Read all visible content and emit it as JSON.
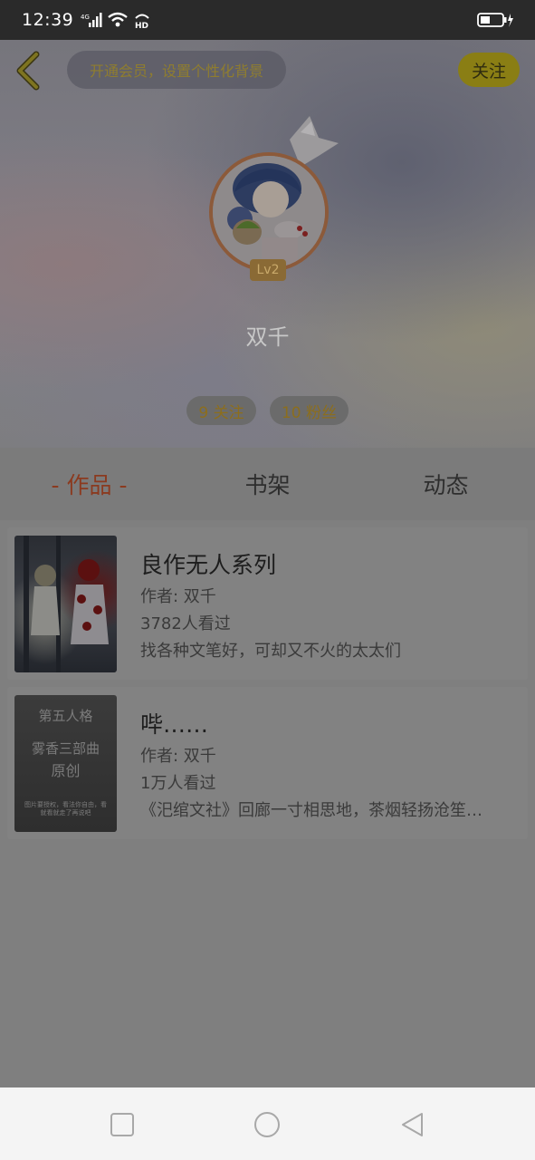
{
  "status_bar": {
    "time": "12:39",
    "network": "4G",
    "hd": "HD"
  },
  "header": {
    "vip_text": "开通会员，设置个性化背景",
    "follow_label": "关注",
    "level": "Lv2",
    "username": "双千",
    "following": "9 关注",
    "fans": "10 粉丝"
  },
  "tabs": [
    {
      "label": "- 作品 -",
      "active": true
    },
    {
      "label": "书架",
      "active": false
    },
    {
      "label": "动态",
      "active": false
    }
  ],
  "works": [
    {
      "title": "良作无人系列",
      "author": "作者: 双千",
      "views": "3782人看过",
      "desc": "找各种文笔好，可却又不火的太太们"
    },
    {
      "title": "哔……",
      "author": "作者: 双千",
      "views": "1万人看过",
      "desc": "《汜绾文社》回廊一寸相思地，茶烟轻扬沧笙…",
      "cover_text": {
        "line1": "第五人格",
        "line2": "雾香三部曲",
        "line3": "原创",
        "small": "图片要授权，看法你自由，看就看就走了再说吧"
      }
    }
  ],
  "colors": {
    "active_tab": "#8b3a1f",
    "follow": "#8a7e14",
    "vip_text": "#8f7d2f"
  }
}
